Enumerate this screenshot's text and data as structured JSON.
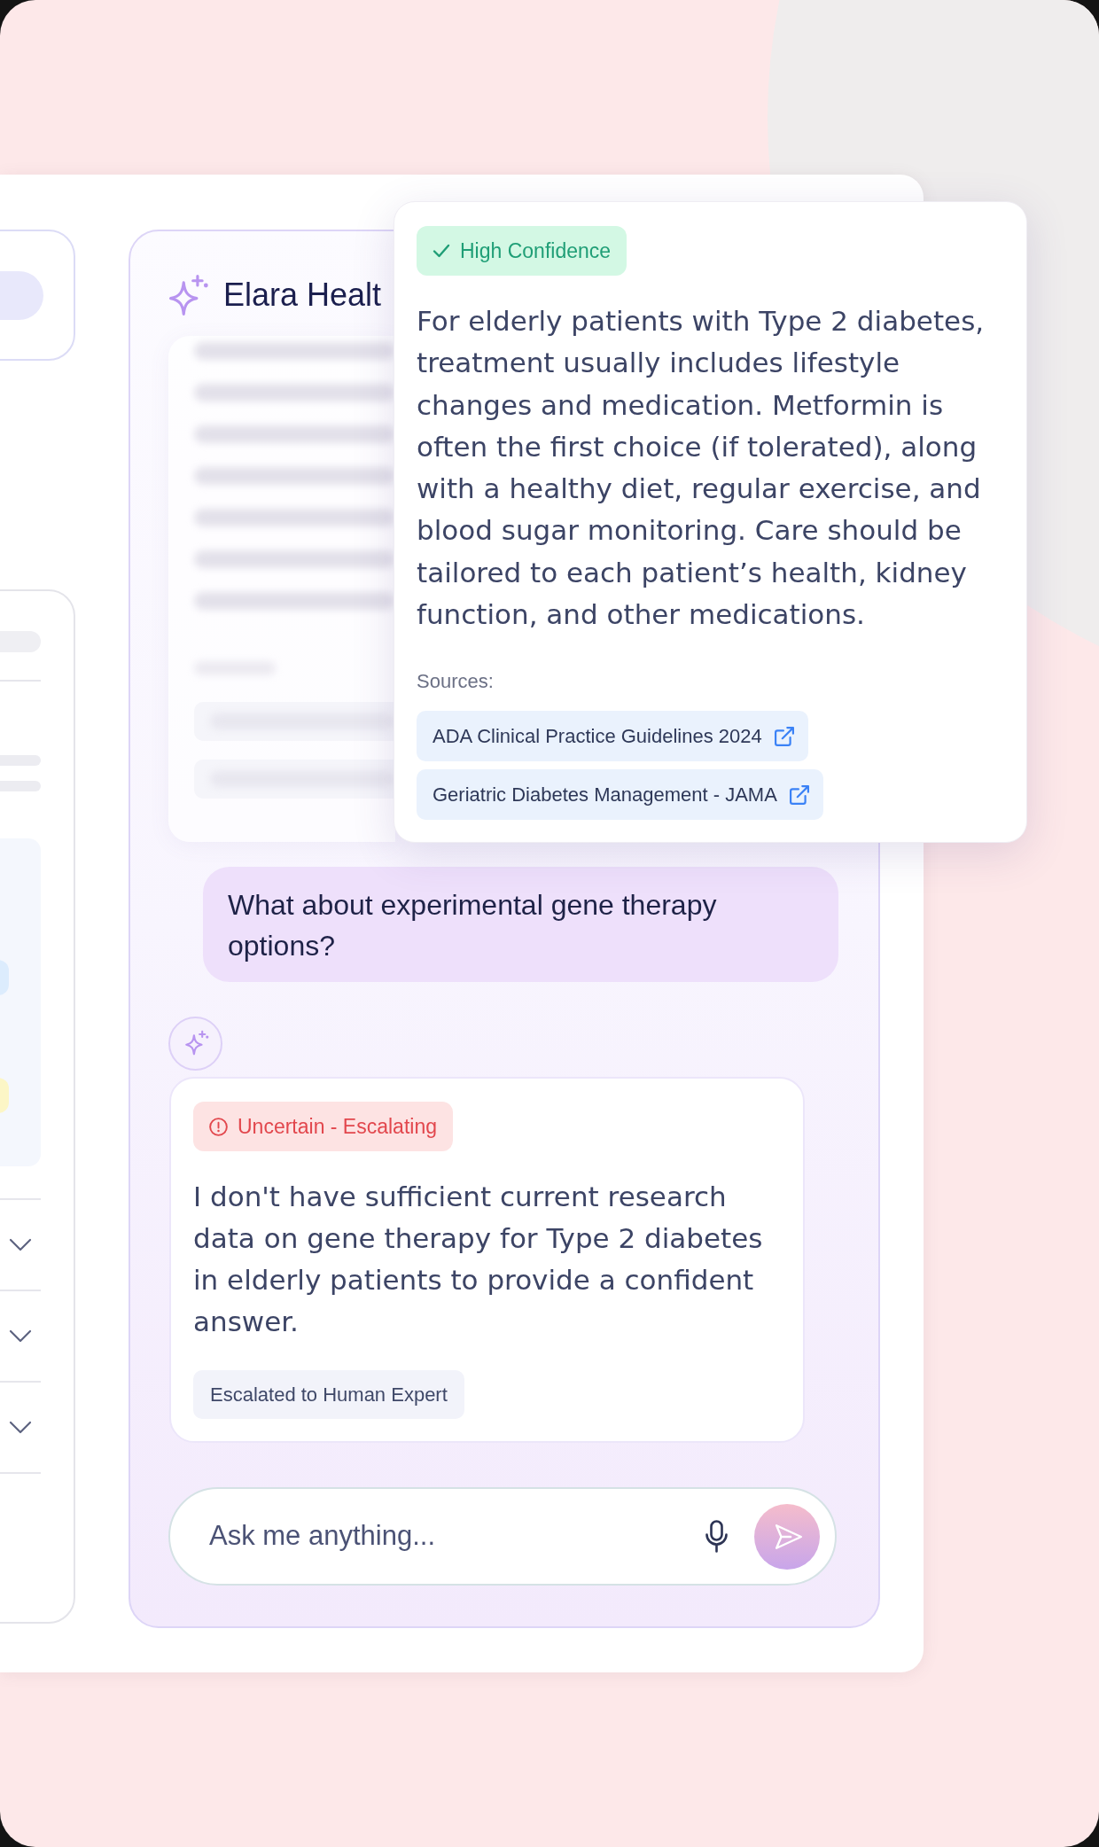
{
  "side_panel": {
    "rows": [
      {
        "expanded": false
      },
      {
        "expanded": false
      },
      {
        "expanded": false
      }
    ]
  },
  "chat": {
    "title": "Elara Healt",
    "messages": [
      {
        "kind": "user",
        "text": "What about experimental gene therapy options?"
      },
      {
        "kind": "assistant",
        "status": {
          "kind": "uncertain",
          "label": "Uncertain - Escalating"
        },
        "text": "I don't have sufficient current research data on gene therapy for Type 2 diabetes in elderly patients to provide a confident answer.",
        "tag": "Escalated to Human Expert"
      }
    ],
    "input": {
      "placeholder": "Ask me anything..."
    }
  },
  "answer_popover": {
    "status": {
      "kind": "high",
      "label": "High Confidence"
    },
    "text": "For elderly patients with Type 2 diabetes, treatment usually includes lifestyle changes and medication. Metformin is often the first choice (if tolerated), along with a healthy diet, regular exercise, and blood sugar monitoring. Care should be tailored to each patient’s health, kidney function, and other medications.",
    "sources_label": "Sources:",
    "sources": [
      "ADA Clinical Practice Guidelines 2024",
      "Geriatric Diabetes Management - JAMA"
    ]
  }
}
